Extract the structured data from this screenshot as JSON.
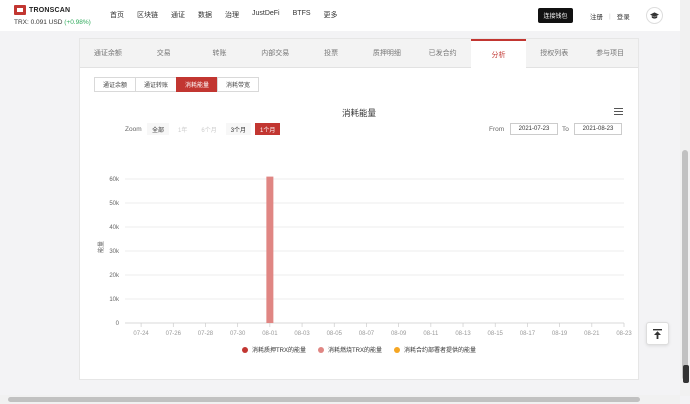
{
  "header": {
    "logo_text": "TRONSCAN",
    "trx_price": "TRX: 0.091 USD",
    "trx_change": "(+0.98%)",
    "nav": [
      "首页",
      "区块链",
      "通证",
      "数据",
      "治理",
      "JustDeFi",
      "BTFS",
      "更多"
    ],
    "connect_wallet": "连接钱包",
    "register": "注册",
    "separator": "|",
    "login": "登录"
  },
  "tabs": [
    {
      "label": "通证余额",
      "active": false
    },
    {
      "label": "交易",
      "active": false
    },
    {
      "label": "转账",
      "active": false
    },
    {
      "label": "内部交易",
      "active": false
    },
    {
      "label": "投票",
      "active": false
    },
    {
      "label": "质押明细",
      "active": false
    },
    {
      "label": "已发合约",
      "active": false
    },
    {
      "label": "分析",
      "active": true
    },
    {
      "label": "授权列表",
      "active": false
    },
    {
      "label": "参与项目",
      "active": false
    }
  ],
  "subtabs": [
    {
      "label": "通证余额",
      "active": false
    },
    {
      "label": "通证转账",
      "active": false
    },
    {
      "label": "消耗能量",
      "active": true
    },
    {
      "label": "消耗带宽",
      "active": false
    }
  ],
  "controls": {
    "zoom_label": "Zoom",
    "zoom_buttons": [
      {
        "label": "全部",
        "state": "normal"
      },
      {
        "label": "1年",
        "state": "disabled"
      },
      {
        "label": "6个月",
        "state": "disabled"
      },
      {
        "label": "3个月",
        "state": "normal"
      },
      {
        "label": "1个月",
        "state": "active"
      }
    ],
    "from_label": "From",
    "from_date": "2021-07-23",
    "to_label": "To",
    "to_date": "2021-08-23"
  },
  "colors": {
    "accent": "#c23631",
    "bar": "#e08683",
    "series1": "#c23631",
    "series2": "#e08683",
    "series3": "#f5a623"
  },
  "chart_data": {
    "type": "bar",
    "title": "消耗能量",
    "ylabel": "能量",
    "ylim": [
      0,
      70000
    ],
    "yticks": [
      {
        "value": 0,
        "label": "0"
      },
      {
        "value": 10000,
        "label": "10k"
      },
      {
        "value": 20000,
        "label": "20k"
      },
      {
        "value": 30000,
        "label": "30k"
      },
      {
        "value": 40000,
        "label": "40k"
      },
      {
        "value": 50000,
        "label": "50k"
      },
      {
        "value": 60000,
        "label": "60k"
      }
    ],
    "x_start": "07-23",
    "x_end": "08-23",
    "xticks": [
      "07-24",
      "07-26",
      "07-28",
      "07-30",
      "08-01",
      "08-03",
      "08-05",
      "08-07",
      "08-09",
      "08-11",
      "08-13",
      "08-15",
      "08-17",
      "08-19",
      "08-21",
      "08-23"
    ],
    "bars": [
      {
        "date": "08-01",
        "series": "消耗燃烧TRX的能量",
        "value": 61000
      }
    ],
    "legend": [
      {
        "name": "消耗质押TRX的能量",
        "color": "#c23631"
      },
      {
        "name": "消耗燃烧TRX的能量",
        "color": "#e08683"
      },
      {
        "name": "消耗合约部署者提供的能量",
        "color": "#f5a623"
      }
    ]
  }
}
